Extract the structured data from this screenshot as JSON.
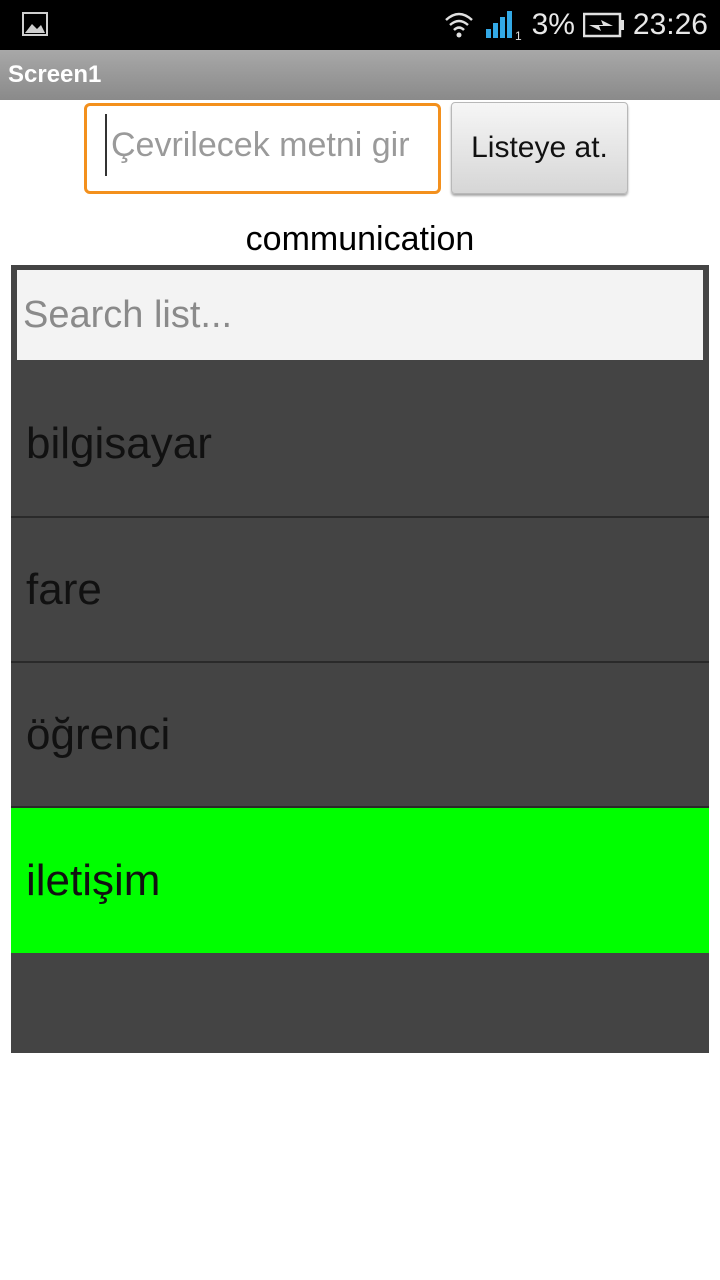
{
  "status_bar": {
    "battery_percent": "3%",
    "time": "23:26",
    "icons": [
      "image-icon",
      "wifi-icon",
      "signal-icon",
      "battery-charging-icon"
    ],
    "signal_sim_label": "1"
  },
  "title_bar": {
    "title": "Screen1"
  },
  "translate_input": {
    "placeholder": "Çevrilecek metni gir",
    "value": "",
    "focus_color": "#f3901d"
  },
  "add_button": {
    "label": "Listeye at."
  },
  "result_label": {
    "text": "communication"
  },
  "list": {
    "search_placeholder": "Search list...",
    "items": [
      {
        "label": "bilgisayar",
        "selected": false
      },
      {
        "label": "fare",
        "selected": false
      },
      {
        "label": "öğrenci",
        "selected": false
      },
      {
        "label": "iletişim",
        "selected": true
      }
    ],
    "background_color": "#444444",
    "selected_color": "#00ff00"
  }
}
